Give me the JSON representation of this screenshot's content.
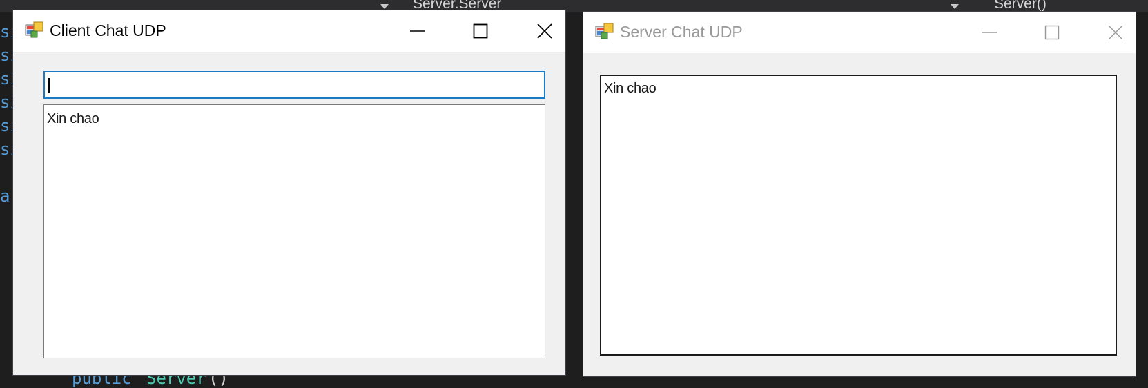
{
  "background": {
    "code_left": [
      "si",
      "si",
      "si",
      "si",
      "si",
      "si",
      "ar"
    ],
    "code_bottom": {
      "keyword": "public",
      "type": "Server",
      "punct": "()"
    },
    "crumbs": [
      "Server.Server",
      "Server()"
    ]
  },
  "client_window": {
    "title": "Client Chat UDP",
    "message_input": {
      "value": "",
      "placeholder": ""
    },
    "chat_log": [
      "Xin chao"
    ],
    "buttons": {
      "minimize": "minimize-icon",
      "maximize": "maximize-icon",
      "close": "close-icon"
    }
  },
  "server_window": {
    "title": "Server Chat UDP",
    "chat_log": [
      "Xin chao"
    ],
    "buttons": {
      "minimize": "minimize-icon",
      "maximize": "maximize-icon",
      "close": "close-icon"
    }
  },
  "colors": {
    "input_focus_border": "#1a7bc4",
    "window_body": "#f0f0f0",
    "ide_background": "#1e1e1e"
  }
}
